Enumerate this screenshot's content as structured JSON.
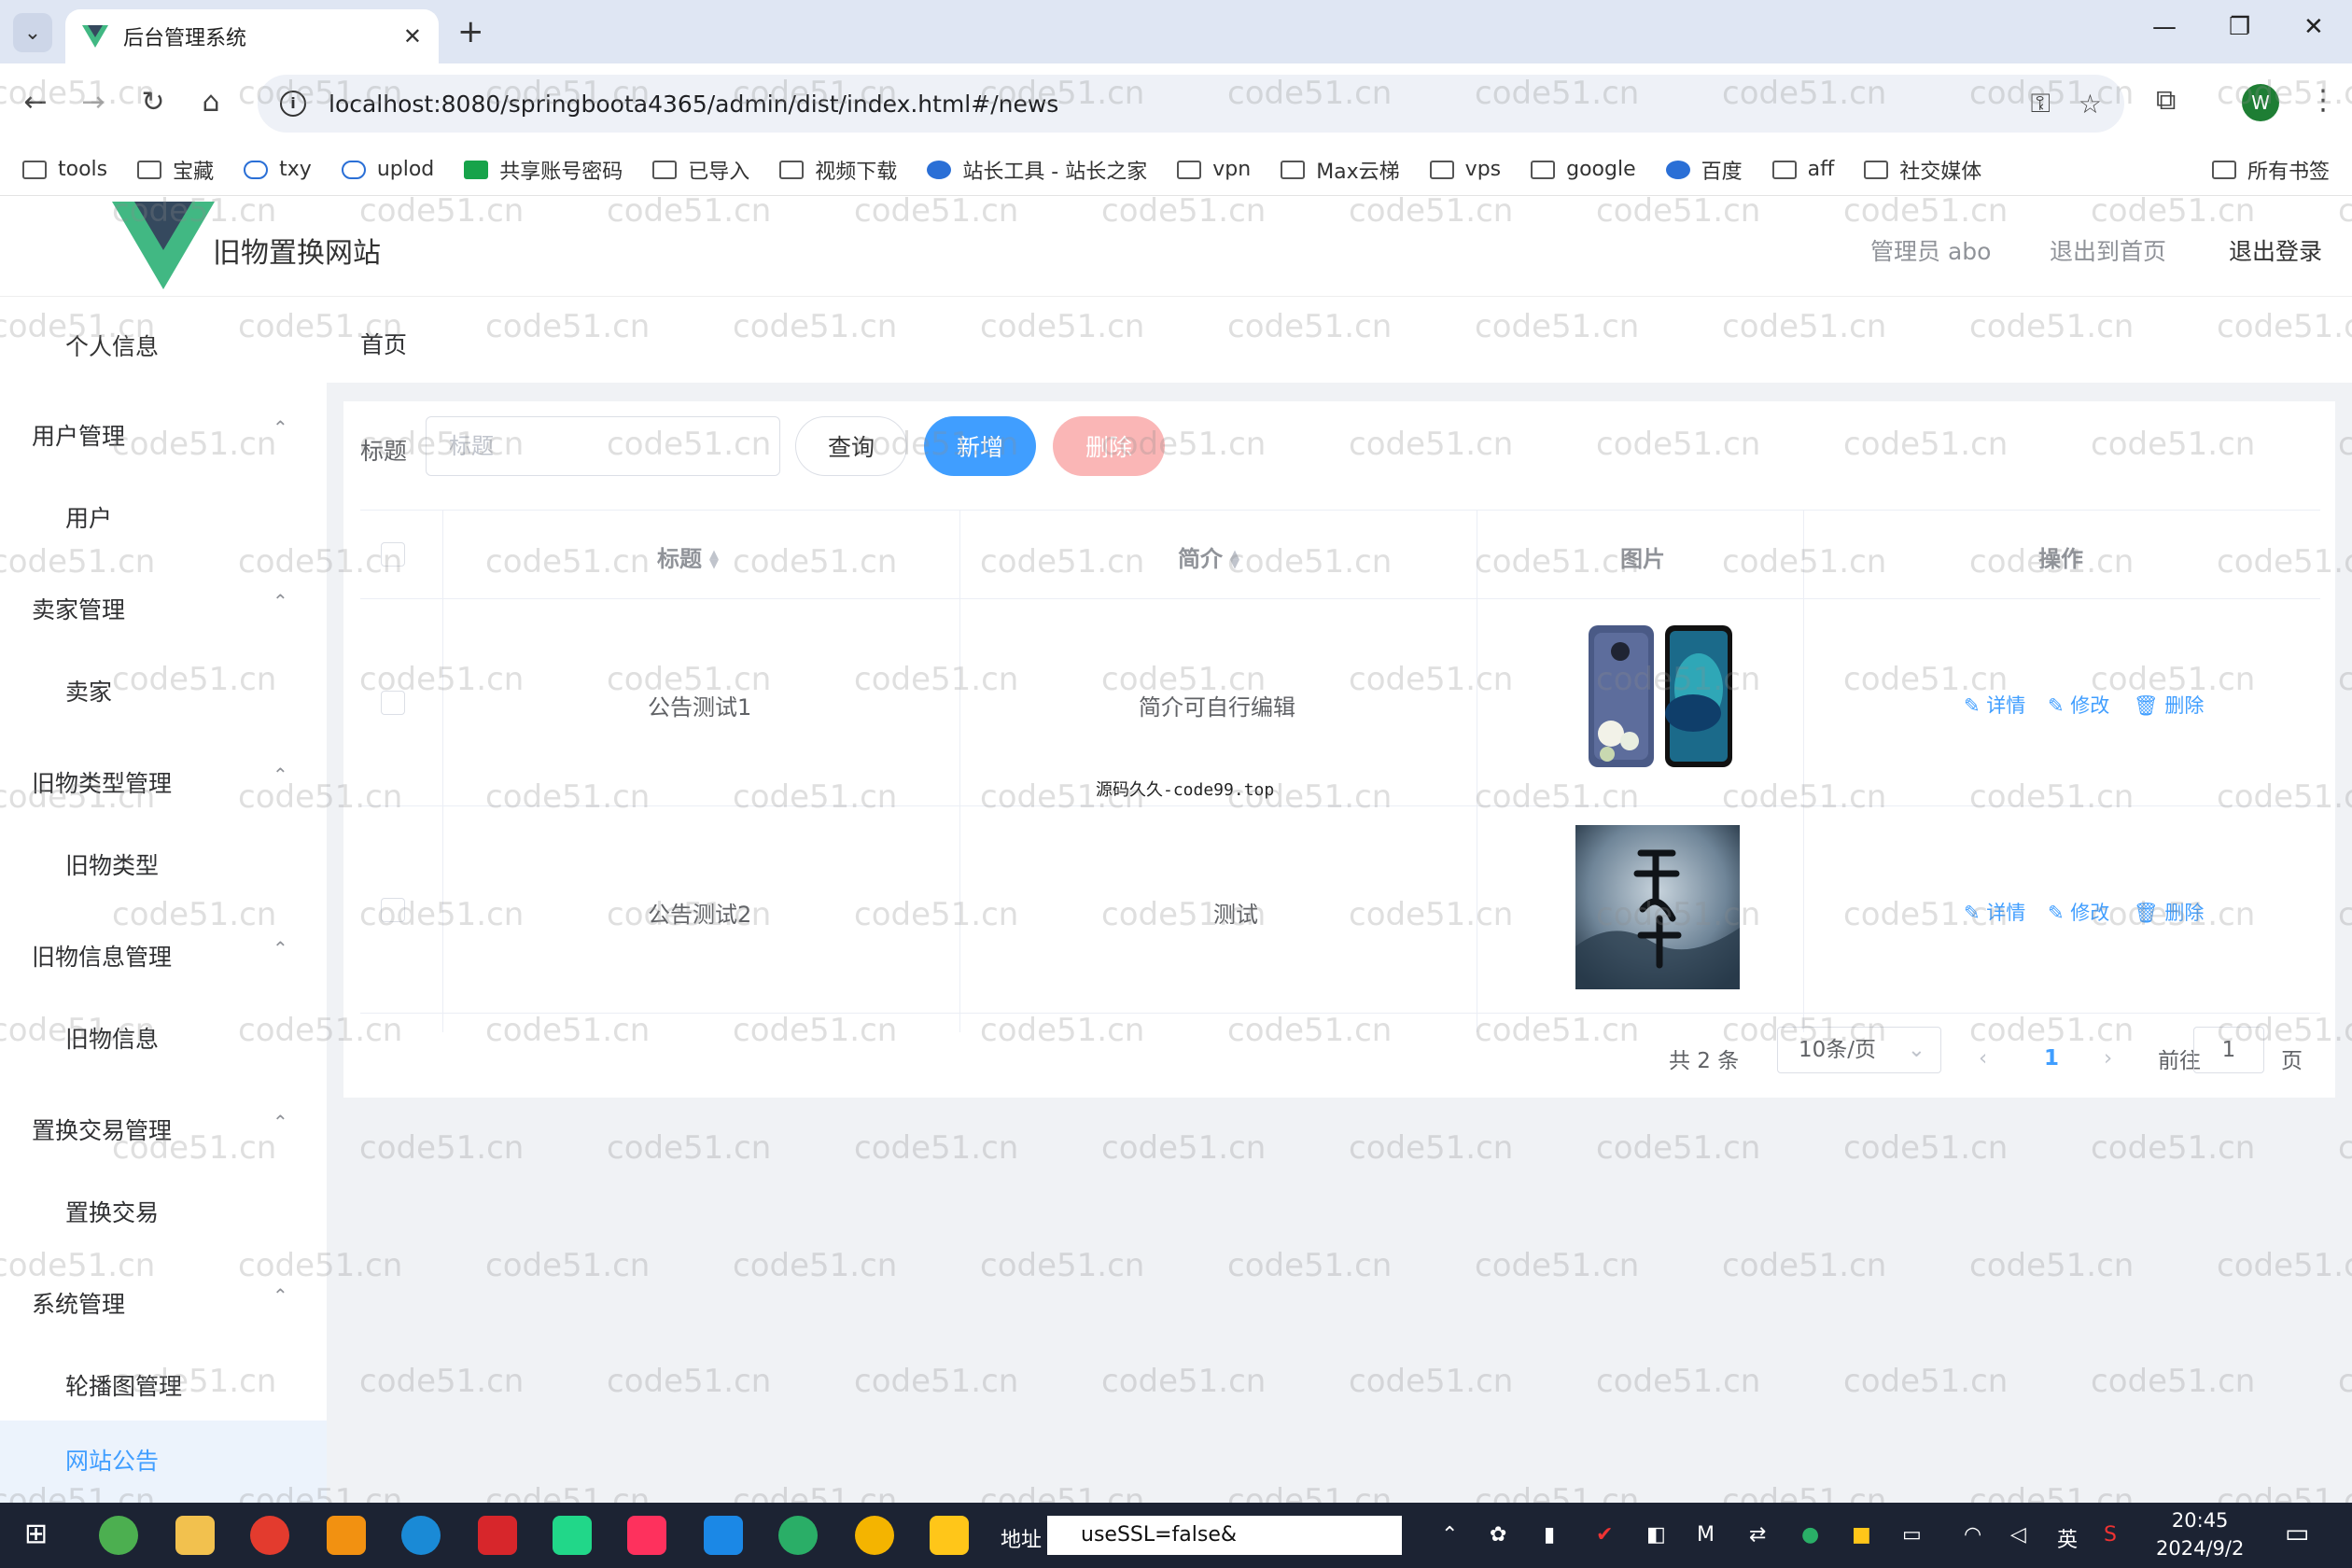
{
  "browser": {
    "tab_title": "后台管理系统",
    "url": "localhost:8080/springboota4365/admin/dist/index.html#/news",
    "profile_initial": "W",
    "bookmarks": [
      "tools",
      "宝藏",
      "txy",
      "uplod",
      "共享账号密码",
      "已导入",
      "视频下载",
      "站长工具 - 站长之家",
      "vpn",
      "Max云梯",
      "vps",
      "google",
      "百度",
      "aff",
      "社交媒体"
    ],
    "all_bookmarks": "所有书签"
  },
  "header": {
    "site_title": "旧物置换网站",
    "admin_label": "管理员 abo",
    "back_home": "退出到首页",
    "logout": "退出登录"
  },
  "sidebar": {
    "profile": "个人信息",
    "groups": [
      {
        "title": "用户管理",
        "item": "用户"
      },
      {
        "title": "卖家管理",
        "item": "卖家"
      },
      {
        "title": "旧物类型管理",
        "item": "旧物类型"
      },
      {
        "title": "旧物信息管理",
        "item": "旧物信息"
      },
      {
        "title": "置换交易管理",
        "item": "置换交易"
      },
      {
        "title": "系统管理",
        "item": "轮播图管理"
      }
    ],
    "active_item": "网站公告"
  },
  "main": {
    "breadcrumb": "首页",
    "search": {
      "label": "标题",
      "placeholder": "标题"
    },
    "buttons": {
      "query": "查询",
      "add": "新增",
      "delete": "删除"
    },
    "columns": {
      "title": "标题",
      "intro": "简介",
      "image": "图片",
      "actions": "操作"
    },
    "rows": [
      {
        "title": "公告测试1",
        "intro": "简介可自行编辑",
        "image_caption": "源码久久-code99.top"
      },
      {
        "title": "公告测试2",
        "intro": "测试"
      }
    ],
    "row_actions": {
      "detail": "详情",
      "edit": "修改",
      "delete": "删除"
    },
    "pagination": {
      "total": "共 2 条",
      "page_size": "10条/页",
      "current": "1",
      "goto": "前往",
      "jump_value": "1",
      "page_unit": "页"
    }
  },
  "watermark": "code51.cn",
  "taskbar": {
    "address_label": "地址",
    "address_value": "useSSL=false&",
    "ime": "英",
    "time": "20:45",
    "date": "2024/9/2"
  }
}
